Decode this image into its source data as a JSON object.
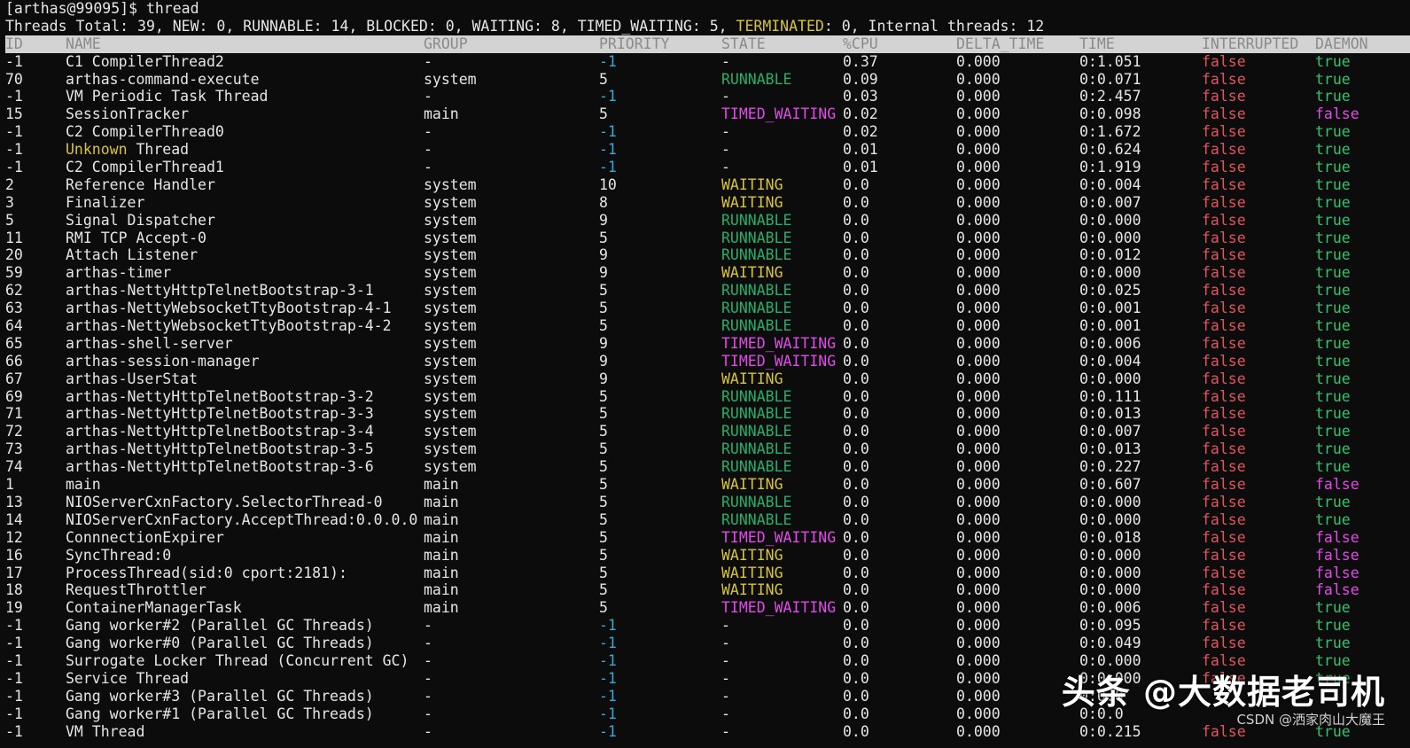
{
  "prompt_line": "[arthas@99095]$ thread",
  "summary": {
    "prefix": "Threads Total: 39, NEW: 0, RUNNABLE: 14, BLOCKED: 0, WAITING: 8, TIMED_WAITING: 5, ",
    "terminated_label": "TERMINATED",
    "suffix": ": 0, Internal threads: 12"
  },
  "columns": [
    "ID",
    "NAME",
    "GROUP",
    "PRIORITY",
    "STATE",
    "%CPU",
    "DELTA_TIME",
    "TIME",
    "INTERRUPTED",
    "DAEMON"
  ],
  "rows": [
    [
      "-1",
      "C1 CompilerThread2",
      "-",
      "-1",
      "-",
      "0.37",
      "0.000",
      "0:1.051",
      "false",
      "true"
    ],
    [
      "70",
      "arthas-command-execute",
      "system",
      "5",
      "RUNNABLE",
      "0.09",
      "0.000",
      "0:0.071",
      "false",
      "true"
    ],
    [
      "-1",
      "VM Periodic Task Thread",
      "-",
      "-1",
      "-",
      "0.03",
      "0.000",
      "0:2.457",
      "false",
      "true"
    ],
    [
      "15",
      "SessionTracker",
      "main",
      "5",
      "TIMED_WAITING",
      "0.02",
      "0.000",
      "0:0.098",
      "false",
      "false"
    ],
    [
      "-1",
      "C2 CompilerThread0",
      "-",
      "-1",
      "-",
      "0.02",
      "0.000",
      "0:1.672",
      "false",
      "true"
    ],
    [
      "-1",
      "Unknown Thread",
      "-",
      "-1",
      "-",
      "0.01",
      "0.000",
      "0:0.624",
      "false",
      "true"
    ],
    [
      "-1",
      "C2 CompilerThread1",
      "-",
      "-1",
      "-",
      "0.01",
      "0.000",
      "0:1.919",
      "false",
      "true"
    ],
    [
      "2",
      "Reference Handler",
      "system",
      "10",
      "WAITING",
      "0.0",
      "0.000",
      "0:0.004",
      "false",
      "true"
    ],
    [
      "3",
      "Finalizer",
      "system",
      "8",
      "WAITING",
      "0.0",
      "0.000",
      "0:0.007",
      "false",
      "true"
    ],
    [
      "5",
      "Signal Dispatcher",
      "system",
      "9",
      "RUNNABLE",
      "0.0",
      "0.000",
      "0:0.000",
      "false",
      "true"
    ],
    [
      "11",
      "RMI TCP Accept-0",
      "system",
      "5",
      "RUNNABLE",
      "0.0",
      "0.000",
      "0:0.000",
      "false",
      "true"
    ],
    [
      "20",
      "Attach Listener",
      "system",
      "9",
      "RUNNABLE",
      "0.0",
      "0.000",
      "0:0.012",
      "false",
      "true"
    ],
    [
      "59",
      "arthas-timer",
      "system",
      "9",
      "WAITING",
      "0.0",
      "0.000",
      "0:0.000",
      "false",
      "true"
    ],
    [
      "62",
      "arthas-NettyHttpTelnetBootstrap-3-1",
      "system",
      "5",
      "RUNNABLE",
      "0.0",
      "0.000",
      "0:0.025",
      "false",
      "true"
    ],
    [
      "63",
      "arthas-NettyWebsocketTtyBootstrap-4-1",
      "system",
      "5",
      "RUNNABLE",
      "0.0",
      "0.000",
      "0:0.001",
      "false",
      "true"
    ],
    [
      "64",
      "arthas-NettyWebsocketTtyBootstrap-4-2",
      "system",
      "5",
      "RUNNABLE",
      "0.0",
      "0.000",
      "0:0.001",
      "false",
      "true"
    ],
    [
      "65",
      "arthas-shell-server",
      "system",
      "9",
      "TIMED_WAITING",
      "0.0",
      "0.000",
      "0:0.006",
      "false",
      "true"
    ],
    [
      "66",
      "arthas-session-manager",
      "system",
      "9",
      "TIMED_WAITING",
      "0.0",
      "0.000",
      "0:0.004",
      "false",
      "true"
    ],
    [
      "67",
      "arthas-UserStat",
      "system",
      "9",
      "WAITING",
      "0.0",
      "0.000",
      "0:0.000",
      "false",
      "true"
    ],
    [
      "69",
      "arthas-NettyHttpTelnetBootstrap-3-2",
      "system",
      "5",
      "RUNNABLE",
      "0.0",
      "0.000",
      "0:0.111",
      "false",
      "true"
    ],
    [
      "71",
      "arthas-NettyHttpTelnetBootstrap-3-3",
      "system",
      "5",
      "RUNNABLE",
      "0.0",
      "0.000",
      "0:0.013",
      "false",
      "true"
    ],
    [
      "72",
      "arthas-NettyHttpTelnetBootstrap-3-4",
      "system",
      "5",
      "RUNNABLE",
      "0.0",
      "0.000",
      "0:0.007",
      "false",
      "true"
    ],
    [
      "73",
      "arthas-NettyHttpTelnetBootstrap-3-5",
      "system",
      "5",
      "RUNNABLE",
      "0.0",
      "0.000",
      "0:0.013",
      "false",
      "true"
    ],
    [
      "74",
      "arthas-NettyHttpTelnetBootstrap-3-6",
      "system",
      "5",
      "RUNNABLE",
      "0.0",
      "0.000",
      "0:0.227",
      "false",
      "true"
    ],
    [
      "1",
      "main",
      "main",
      "5",
      "WAITING",
      "0.0",
      "0.000",
      "0:0.607",
      "false",
      "false"
    ],
    [
      "13",
      "NIOServerCxnFactory.SelectorThread-0",
      "main",
      "5",
      "RUNNABLE",
      "0.0",
      "0.000",
      "0:0.000",
      "false",
      "true"
    ],
    [
      "14",
      "NIOServerCxnFactory.AcceptThread:0.0.0.0",
      "main",
      "5",
      "RUNNABLE",
      "0.0",
      "0.000",
      "0:0.000",
      "false",
      "true"
    ],
    [
      "12",
      "ConnnectionExpirer",
      "main",
      "5",
      "TIMED_WAITING",
      "0.0",
      "0.000",
      "0:0.018",
      "false",
      "false"
    ],
    [
      "16",
      "SyncThread:0",
      "main",
      "5",
      "WAITING",
      "0.0",
      "0.000",
      "0:0.000",
      "false",
      "false"
    ],
    [
      "17",
      "ProcessThread(sid:0 cport:2181):",
      "main",
      "5",
      "WAITING",
      "0.0",
      "0.000",
      "0:0.000",
      "false",
      "false"
    ],
    [
      "18",
      "RequestThrottler",
      "main",
      "5",
      "WAITING",
      "0.0",
      "0.000",
      "0:0.000",
      "false",
      "false"
    ],
    [
      "19",
      "ContainerManagerTask",
      "main",
      "5",
      "TIMED_WAITING",
      "0.0",
      "0.000",
      "0:0.006",
      "false",
      "true"
    ],
    [
      "-1",
      "Gang worker#2 (Parallel GC Threads)",
      "-",
      "-1",
      "-",
      "0.0",
      "0.000",
      "0:0.095",
      "false",
      "true"
    ],
    [
      "-1",
      "Gang worker#0 (Parallel GC Threads)",
      "-",
      "-1",
      "-",
      "0.0",
      "0.000",
      "0:0.049",
      "false",
      "true"
    ],
    [
      "-1",
      "Surrogate Locker Thread (Concurrent GC)",
      "-",
      "-1",
      "-",
      "0.0",
      "0.000",
      "0:0.000",
      "false",
      "true"
    ],
    [
      "-1",
      "Service Thread",
      "-",
      "-1",
      "-",
      "0.0",
      "0.000",
      "0:0.000",
      "false",
      "true"
    ],
    [
      "-1",
      "Gang worker#3 (Parallel GC Threads)",
      "-",
      "-1",
      "-",
      "0.0",
      "0.000",
      "0:0.0",
      "",
      ""
    ],
    [
      "-1",
      "Gang worker#1 (Parallel GC Threads)",
      "-",
      "-1",
      "-",
      "0.0",
      "0.000",
      "0:0.0",
      "",
      ""
    ],
    [
      "-1",
      "VM Thread",
      "-",
      "-1",
      "-",
      "0.0",
      "0.000",
      "0:0.215",
      "false",
      "true"
    ]
  ],
  "watermark": {
    "main": "头条 @大数据老司机",
    "sub": "CSDN @洒家肉山大魔王"
  },
  "colors": {
    "background": "#0c0c0c",
    "header_bg": "#d3d3d3",
    "runnable": "#23b06b",
    "waiting": "#d7c33c",
    "timed_waiting": "#e14ae8",
    "false": "#e2545c",
    "true": "#2ec46c",
    "negative_priority": "#3aa7d6"
  }
}
